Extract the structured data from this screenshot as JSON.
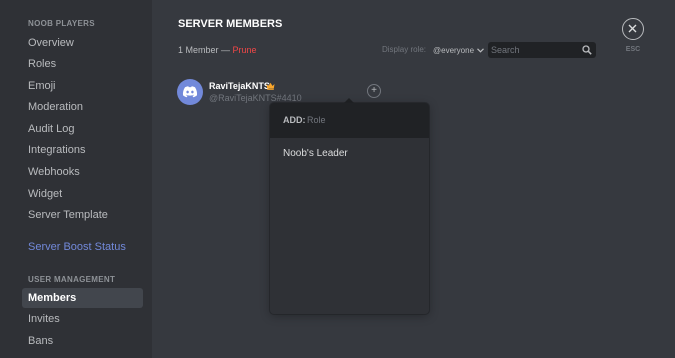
{
  "sidebar": {
    "section_server": "NOOB PLAYERS",
    "items": [
      {
        "label": "Overview"
      },
      {
        "label": "Roles"
      },
      {
        "label": "Emoji"
      },
      {
        "label": "Moderation"
      },
      {
        "label": "Audit Log"
      },
      {
        "label": "Integrations"
      },
      {
        "label": "Webhooks"
      },
      {
        "label": "Widget"
      },
      {
        "label": "Server Template"
      }
    ],
    "boost_label": "Server Boost Status",
    "section_user_management": "USER MANAGEMENT",
    "user_items": [
      {
        "label": "Members",
        "selected": true
      },
      {
        "label": "Invites"
      },
      {
        "label": "Bans"
      }
    ]
  },
  "main": {
    "title": "SERVER MEMBERS",
    "member_count_text": "1 Member —",
    "prune_label": "Prune",
    "display_role_label": "Display role:",
    "display_role_value": "@everyone",
    "search_placeholder": "Search",
    "close_hint": "ESC"
  },
  "member": {
    "name": "RaviTejaKNTS",
    "tag": "@RaviTejaKNTS#4410",
    "add_role_symbol": "+",
    "badge": "crown-icon"
  },
  "role_popout": {
    "add_label": "ADD:",
    "placeholder": "Role",
    "options": [
      "Noob's Leader"
    ]
  },
  "colors": {
    "background": "#36393f",
    "sidebar": "#2f3136",
    "accent": "#7289da",
    "danger": "#f04747",
    "crown": "#f9a62b"
  }
}
